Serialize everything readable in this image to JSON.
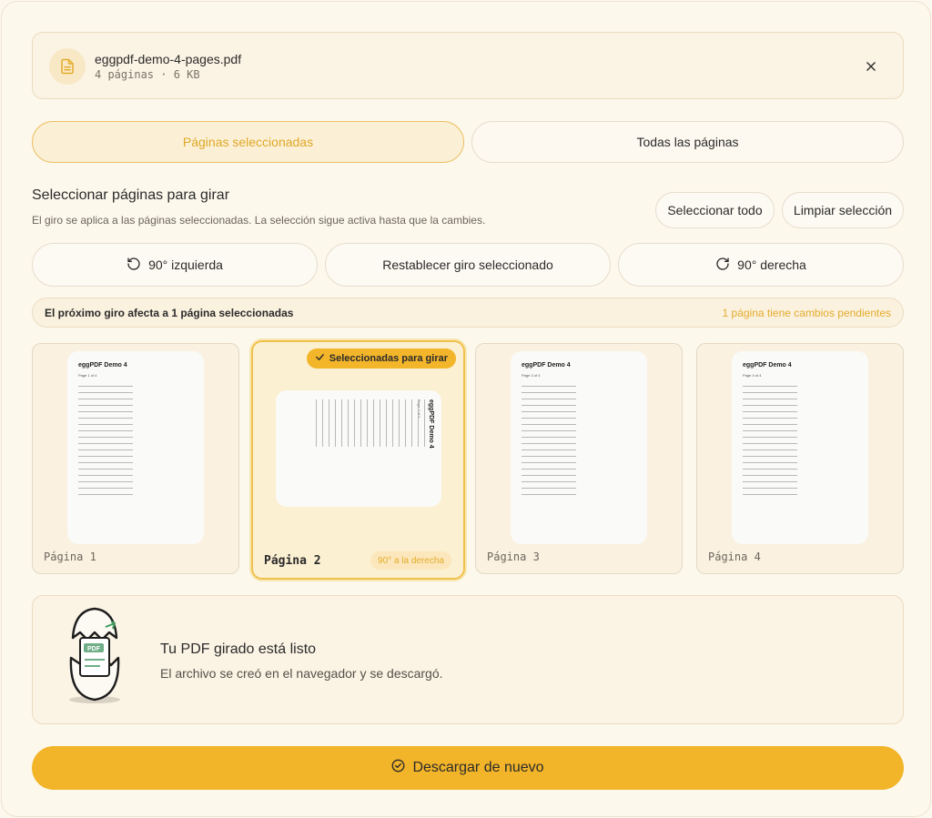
{
  "file": {
    "name": "eggpdf-demo-4-pages.pdf",
    "meta": "4 páginas · 6 KB"
  },
  "mode_tabs": {
    "selected_label": "Páginas seleccionadas",
    "all_label": "Todas las páginas"
  },
  "section": {
    "title": "Seleccionar páginas para girar",
    "description": "El giro se aplica a las páginas seleccionadas. La selección sigue activa hasta que la cambies.",
    "select_all": "Seleccionar todo",
    "clear_selection": "Limpiar selección"
  },
  "rotate": {
    "left": "90° izquierda",
    "reset": "Restablecer giro seleccionado",
    "right": "90° derecha"
  },
  "info": {
    "next_rotation": "El próximo giro afecta a 1 página seleccionadas",
    "pending": "1 página tiene cambios pendientes"
  },
  "pages": [
    {
      "label": "Página 1",
      "thumb_title": "eggPDF Demo 4",
      "thumb_sub": "Page 1 of 4"
    },
    {
      "label": "Página 2",
      "thumb_title": "eggPDF Demo 4",
      "thumb_sub": "Page 2 of 4",
      "badge": "Seleccionadas para girar",
      "rotation": "90° a la derecha"
    },
    {
      "label": "Página 3",
      "thumb_title": "eggPDF Demo 4",
      "thumb_sub": "Page 3 of 4"
    },
    {
      "label": "Página 4",
      "thumb_title": "eggPDF Demo 4",
      "thumb_sub": "Page 4 of 4"
    }
  ],
  "result": {
    "title": "Tu PDF girado está listo",
    "description": "El archivo se creó en el navegador y se descargó.",
    "illustration_text": "PDF"
  },
  "download_label": "Descargar de nuevo",
  "colors": {
    "accent": "#f2b428",
    "accent_text": "#e0a826",
    "background": "#fdf8ec"
  },
  "icons": {
    "file": "document-icon",
    "close": "close-icon",
    "rotate_left": "rotate-left-icon",
    "rotate_right": "rotate-right-icon",
    "check": "check-icon",
    "download": "check-circle-icon"
  }
}
